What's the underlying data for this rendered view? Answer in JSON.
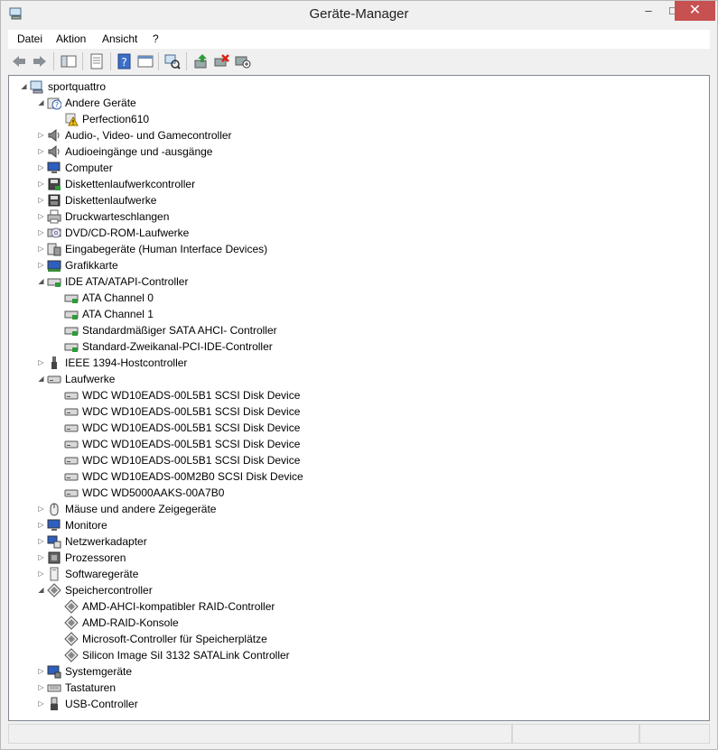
{
  "window": {
    "title": "Geräte-Manager",
    "minimize_glyph": "‒",
    "maximize_glyph": "□",
    "close_glyph": "✕"
  },
  "menu": [
    "Datei",
    "Aktion",
    "Ansicht",
    "?"
  ],
  "toolbar": [
    "back-icon",
    "forward-icon",
    "show-hide-tree-icon",
    "properties-icon",
    "help-icon",
    "view-icon",
    "scan-hardware-icon",
    "update-driver-icon",
    "uninstall-device-icon",
    "add-legacy-hardware-icon"
  ],
  "tree": [
    {
      "label": "sportquattro",
      "level": 0,
      "state": "expanded",
      "icon": "computer-root-icon"
    },
    {
      "label": "Andere Geräte",
      "level": 1,
      "state": "expanded",
      "icon": "unknown-device-icon"
    },
    {
      "label": "Perfection610",
      "level": 2,
      "state": "leaf",
      "icon": "warning-device-icon"
    },
    {
      "label": "Audio-, Video- und Gamecontroller",
      "level": 1,
      "state": "collapsed",
      "icon": "speaker-icon"
    },
    {
      "label": "Audioeingänge und -ausgänge",
      "level": 1,
      "state": "collapsed",
      "icon": "speaker-icon"
    },
    {
      "label": "Computer",
      "level": 1,
      "state": "collapsed",
      "icon": "monitor-icon"
    },
    {
      "label": "Diskettenlaufwerkcontroller",
      "level": 1,
      "state": "collapsed",
      "icon": "floppy-controller-icon"
    },
    {
      "label": "Diskettenlaufwerke",
      "level": 1,
      "state": "collapsed",
      "icon": "floppy-drive-icon"
    },
    {
      "label": "Druckwarteschlangen",
      "level": 1,
      "state": "collapsed",
      "icon": "printer-icon"
    },
    {
      "label": "DVD/CD-ROM-Laufwerke",
      "level": 1,
      "state": "collapsed",
      "icon": "dvd-icon"
    },
    {
      "label": "Eingabegeräte (Human Interface Devices)",
      "level": 1,
      "state": "collapsed",
      "icon": "hid-icon"
    },
    {
      "label": "Grafikkarte",
      "level": 1,
      "state": "collapsed",
      "icon": "display-adapter-icon"
    },
    {
      "label": "IDE ATA/ATAPI-Controller",
      "level": 1,
      "state": "expanded",
      "icon": "ide-controller-icon"
    },
    {
      "label": "ATA Channel 0",
      "level": 2,
      "state": "leaf",
      "icon": "ide-controller-icon"
    },
    {
      "label": "ATA Channel 1",
      "level": 2,
      "state": "leaf",
      "icon": "ide-controller-icon"
    },
    {
      "label": "Standardmäßiger SATA AHCI- Controller",
      "level": 2,
      "state": "leaf",
      "icon": "ide-controller-icon"
    },
    {
      "label": "Standard-Zweikanal-PCI-IDE-Controller",
      "level": 2,
      "state": "leaf",
      "icon": "ide-controller-icon"
    },
    {
      "label": "IEEE 1394-Hostcontroller",
      "level": 1,
      "state": "collapsed",
      "icon": "firewire-icon"
    },
    {
      "label": "Laufwerke",
      "level": 1,
      "state": "expanded",
      "icon": "disk-drive-icon"
    },
    {
      "label": "WDC WD10EADS-00L5B1 SCSI Disk Device",
      "level": 2,
      "state": "leaf",
      "icon": "disk-drive-icon"
    },
    {
      "label": "WDC WD10EADS-00L5B1 SCSI Disk Device",
      "level": 2,
      "state": "leaf",
      "icon": "disk-drive-icon"
    },
    {
      "label": "WDC WD10EADS-00L5B1 SCSI Disk Device",
      "level": 2,
      "state": "leaf",
      "icon": "disk-drive-icon"
    },
    {
      "label": "WDC WD10EADS-00L5B1 SCSI Disk Device",
      "level": 2,
      "state": "leaf",
      "icon": "disk-drive-icon"
    },
    {
      "label": "WDC WD10EADS-00L5B1 SCSI Disk Device",
      "level": 2,
      "state": "leaf",
      "icon": "disk-drive-icon"
    },
    {
      "label": "WDC WD10EADS-00M2B0 SCSI Disk Device",
      "level": 2,
      "state": "leaf",
      "icon": "disk-drive-icon"
    },
    {
      "label": "WDC WD5000AAKS-00A7B0",
      "level": 2,
      "state": "leaf",
      "icon": "disk-drive-icon"
    },
    {
      "label": "Mäuse und andere Zeigegeräte",
      "level": 1,
      "state": "collapsed",
      "icon": "mouse-icon"
    },
    {
      "label": "Monitore",
      "level": 1,
      "state": "collapsed",
      "icon": "monitor-icon"
    },
    {
      "label": "Netzwerkadapter",
      "level": 1,
      "state": "collapsed",
      "icon": "network-adapter-icon"
    },
    {
      "label": "Prozessoren",
      "level": 1,
      "state": "collapsed",
      "icon": "processor-icon"
    },
    {
      "label": "Softwaregeräte",
      "level": 1,
      "state": "collapsed",
      "icon": "software-device-icon"
    },
    {
      "label": "Speichercontroller",
      "level": 1,
      "state": "expanded",
      "icon": "storage-controller-icon"
    },
    {
      "label": "AMD-AHCI-kompatibler RAID-Controller",
      "level": 2,
      "state": "leaf",
      "icon": "storage-controller-icon"
    },
    {
      "label": "AMD-RAID-Konsole",
      "level": 2,
      "state": "leaf",
      "icon": "storage-controller-icon"
    },
    {
      "label": "Microsoft-Controller für Speicherplätze",
      "level": 2,
      "state": "leaf",
      "icon": "storage-controller-icon"
    },
    {
      "label": "Silicon Image SiI 3132 SATALink Controller",
      "level": 2,
      "state": "leaf",
      "icon": "storage-controller-icon"
    },
    {
      "label": "Systemgeräte",
      "level": 1,
      "state": "collapsed",
      "icon": "system-device-icon"
    },
    {
      "label": "Tastaturen",
      "level": 1,
      "state": "collapsed",
      "icon": "keyboard-icon"
    },
    {
      "label": "USB-Controller",
      "level": 1,
      "state": "collapsed",
      "icon": "usb-icon"
    }
  ],
  "glyphs": {
    "expanded": "◢",
    "collapsed": "▷"
  }
}
